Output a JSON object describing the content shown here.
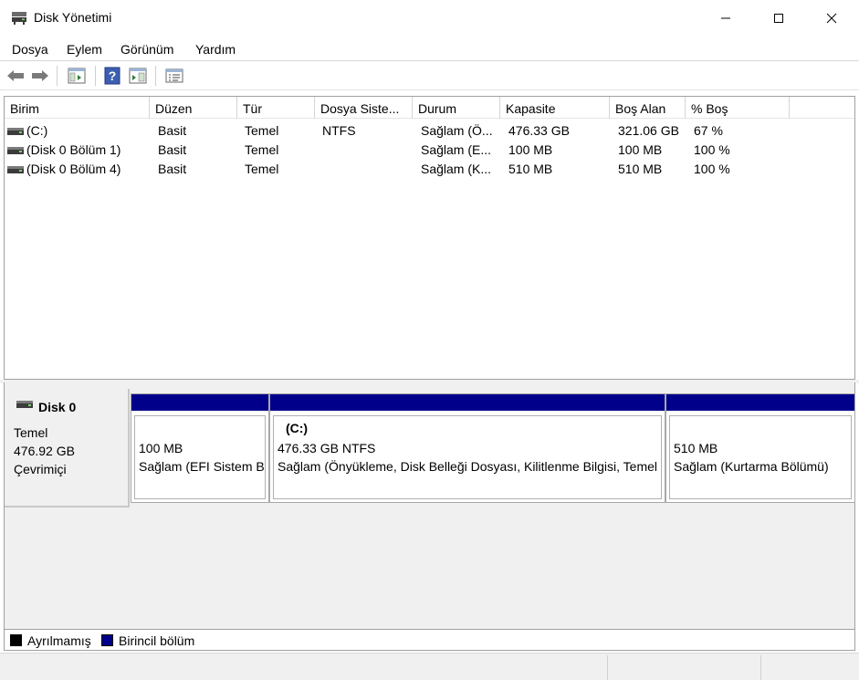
{
  "window": {
    "title": "Disk Yönetimi",
    "icon": "disk-management-icon"
  },
  "menu": [
    "Dosya",
    "Eylem",
    "Görünüm",
    "Yardım"
  ],
  "toolbar": {
    "icons": [
      "back-arrow-icon",
      "forward-arrow-icon",
      "console-tree-icon",
      "help-icon",
      "action-pane-icon",
      "properties-icon"
    ]
  },
  "volume_list": {
    "columns": [
      "Birim",
      "Düzen",
      "Tür",
      "Dosya Siste...",
      "Durum",
      "Kapasite",
      "Boş Alan",
      "% Boş"
    ],
    "rows": [
      {
        "birim": " (C:)",
        "duzen": "Basit",
        "tur": "Temel",
        "dosya_sistemi": "NTFS",
        "durum": "Sağlam (Ö...",
        "kapasite": "476.33 GB",
        "bos_alan": "321.06 GB",
        "yuzde_bos": "67 %"
      },
      {
        "birim": "(Disk 0 Bölüm 1)",
        "duzen": "Basit",
        "tur": "Temel",
        "dosya_sistemi": "",
        "durum": "Sağlam (E...",
        "kapasite": "100 MB",
        "bos_alan": "100 MB",
        "yuzde_bos": "100 %"
      },
      {
        "birim": "(Disk 0 Bölüm 4)",
        "duzen": "Basit",
        "tur": "Temel",
        "dosya_sistemi": "",
        "durum": "Sağlam (K...",
        "kapasite": "510 MB",
        "bos_alan": "510 MB",
        "yuzde_bos": "100 %"
      }
    ]
  },
  "disk": {
    "name": "Disk 0",
    "type": "Temel",
    "size": "476.92 GB",
    "state": "Çevrimiçi",
    "partitions": [
      {
        "title": "",
        "size": "100 MB",
        "status": "Sağlam (EFI Sistem Bölümü)"
      },
      {
        "title": "(C:)",
        "size": "476.33 GB NTFS",
        "status": "Sağlam (Önyükleme, Disk Belleği Dosyası, Kilitlenme Bilgisi, Temel Veri Bölümü)"
      },
      {
        "title": "",
        "size": "510 MB",
        "status": "Sağlam (Kurtarma Bölümü)"
      }
    ]
  },
  "legend": [
    {
      "label": "Ayrılmamış",
      "color": "#000000"
    },
    {
      "label": "Birincil bölüm",
      "color": "#00008b"
    }
  ],
  "colors": {
    "primary_partition": "#00008b",
    "unallocated": "#000000"
  }
}
